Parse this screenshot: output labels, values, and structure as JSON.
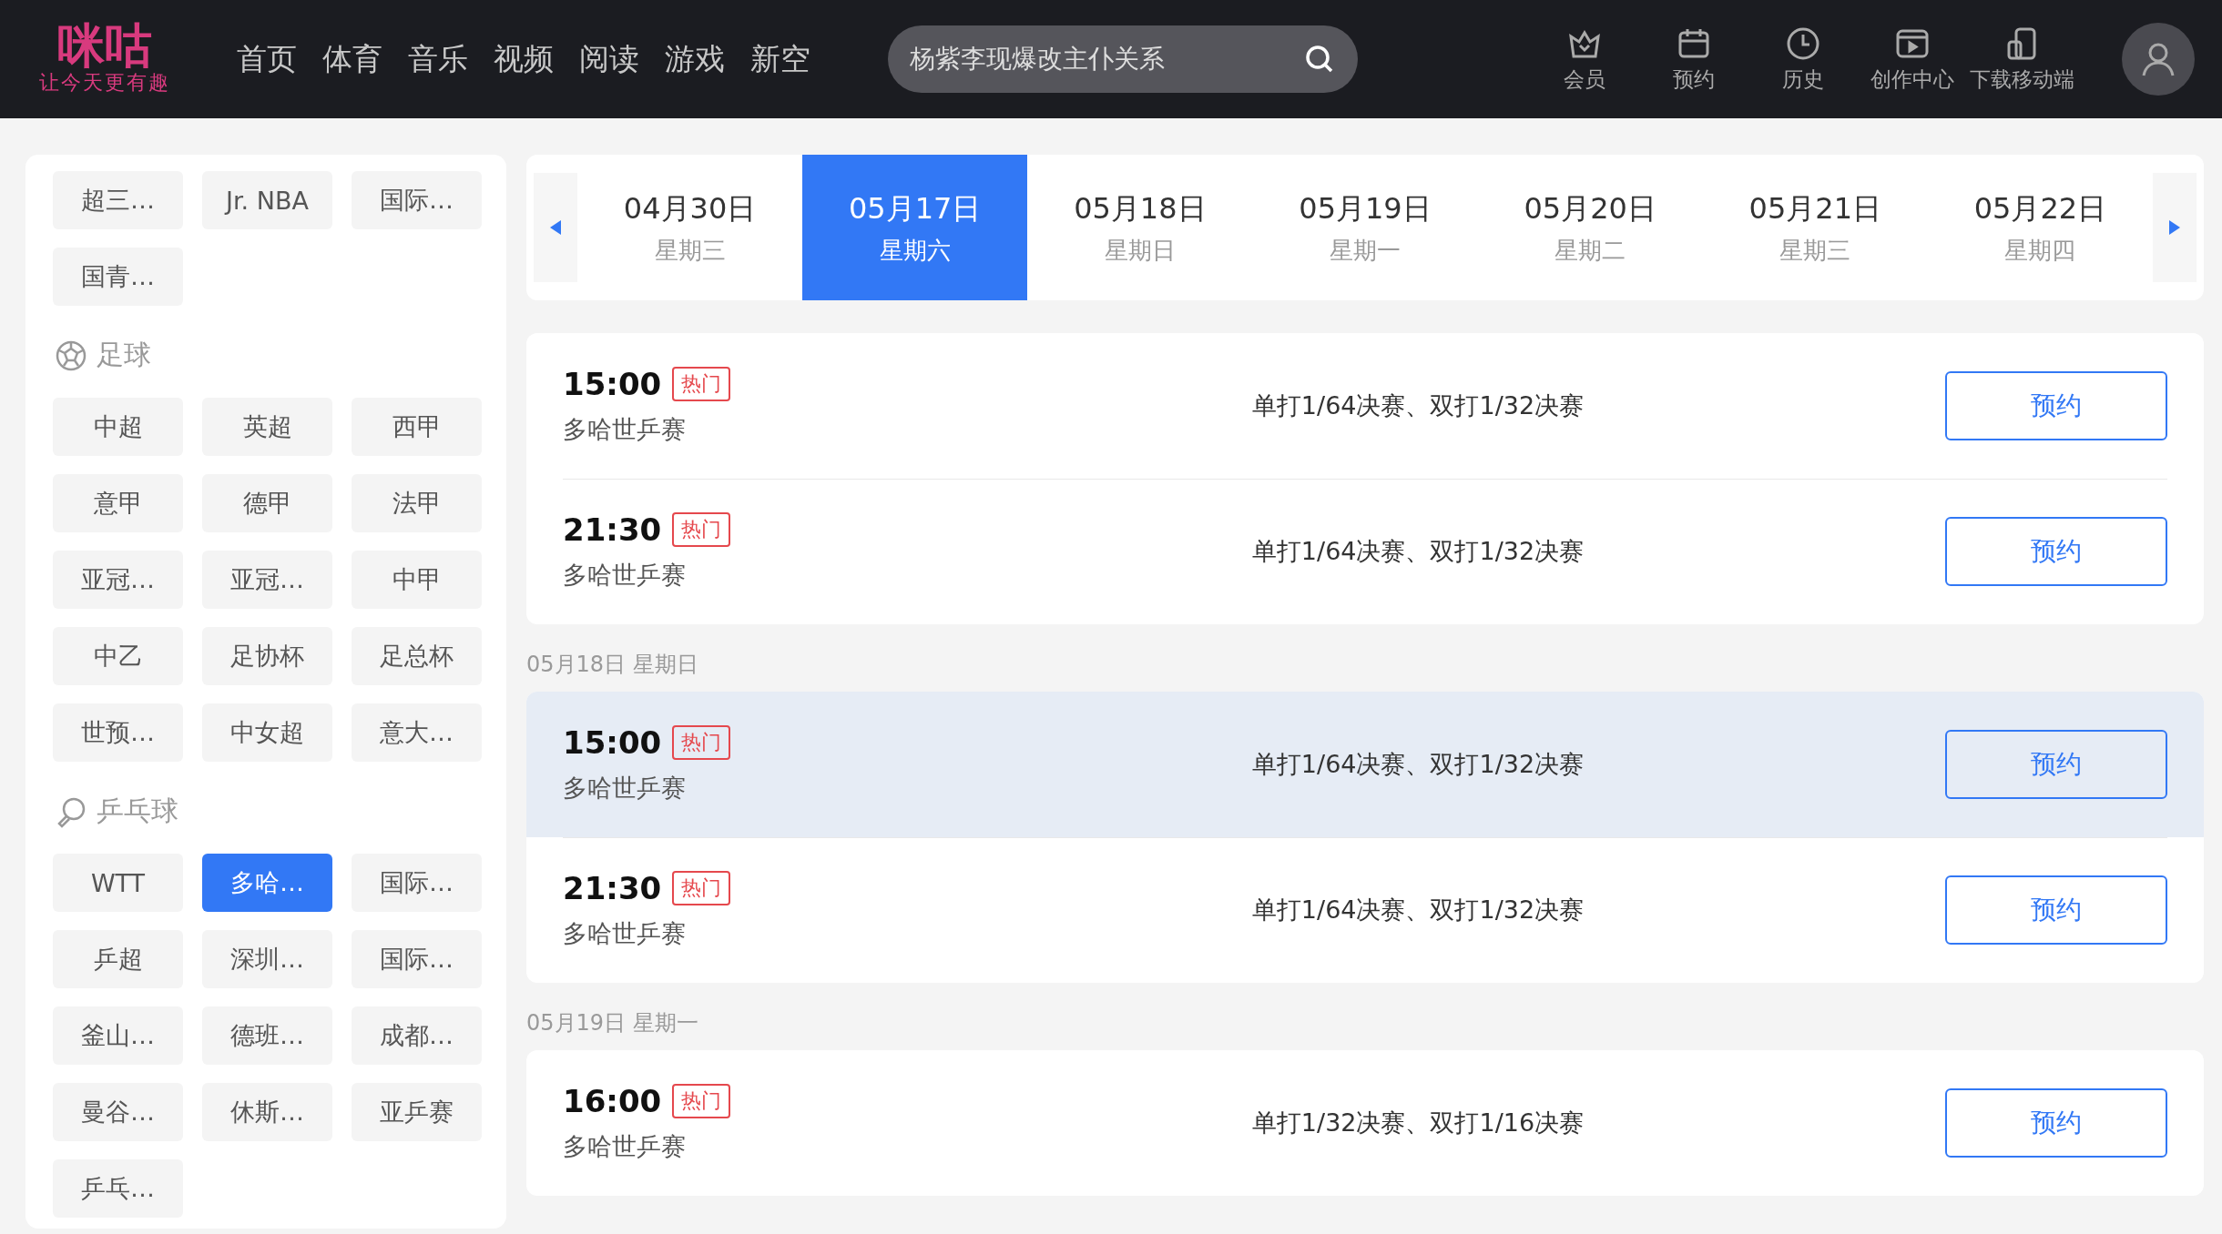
{
  "header": {
    "logo": {
      "name": "咪咕",
      "slogan": "让今天更有趣"
    },
    "nav": [
      {
        "label": "首页"
      },
      {
        "label": "体育"
      },
      {
        "label": "音乐"
      },
      {
        "label": "视频"
      },
      {
        "label": "阅读"
      },
      {
        "label": "游戏"
      },
      {
        "label": "新空"
      }
    ],
    "search": {
      "value": "杨紫李现爆改主仆关系"
    },
    "actions": [
      {
        "kind": "crown",
        "label": "会员"
      },
      {
        "kind": "calendar",
        "label": "预约"
      },
      {
        "kind": "clock",
        "label": "历史"
      },
      {
        "kind": "video",
        "label": "创作中心"
      },
      {
        "kind": "phone",
        "label": "下载移动端"
      }
    ]
  },
  "sidebar": {
    "sections": [
      {
        "items": [
          {
            "label": "超三…",
            "selected": false
          },
          {
            "label": "Jr. NBA",
            "selected": false
          },
          {
            "label": "国际…",
            "selected": false
          },
          {
            "label": "国青…",
            "selected": false
          }
        ]
      },
      {
        "title": "足球",
        "kind": "football",
        "items": [
          {
            "label": "中超",
            "selected": false
          },
          {
            "label": "英超",
            "selected": false
          },
          {
            "label": "西甲",
            "selected": false
          },
          {
            "label": "意甲",
            "selected": false
          },
          {
            "label": "德甲",
            "selected": false
          },
          {
            "label": "法甲",
            "selected": false
          },
          {
            "label": "亚冠…",
            "selected": false
          },
          {
            "label": "亚冠…",
            "selected": false
          },
          {
            "label": "中甲",
            "selected": false
          },
          {
            "label": "中乙",
            "selected": false
          },
          {
            "label": "足协杯",
            "selected": false
          },
          {
            "label": "足总杯",
            "selected": false
          },
          {
            "label": "世预…",
            "selected": false
          },
          {
            "label": "中女超",
            "selected": false
          },
          {
            "label": "意大…",
            "selected": false
          }
        ]
      },
      {
        "title": "乒乓球",
        "kind": "pingpong",
        "items": [
          {
            "label": "WTT",
            "selected": false
          },
          {
            "label": "多哈…",
            "selected": true
          },
          {
            "label": "国际…",
            "selected": false
          },
          {
            "label": "乒超",
            "selected": false
          },
          {
            "label": "深圳…",
            "selected": false
          },
          {
            "label": "国际…",
            "selected": false
          },
          {
            "label": "釜山…",
            "selected": false
          },
          {
            "label": "德班…",
            "selected": false
          },
          {
            "label": "成都…",
            "selected": false
          },
          {
            "label": "曼谷…",
            "selected": false
          },
          {
            "label": "休斯…",
            "selected": false
          },
          {
            "label": "亚乒赛",
            "selected": false
          },
          {
            "label": "乒乓…",
            "selected": false
          }
        ]
      }
    ]
  },
  "dates": [
    {
      "date": "04月30日",
      "weekday": "星期三",
      "selected": false
    },
    {
      "date": "05月17日",
      "weekday": "星期六",
      "selected": true
    },
    {
      "date": "05月18日",
      "weekday": "星期日",
      "selected": false
    },
    {
      "date": "05月19日",
      "weekday": "星期一",
      "selected": false
    },
    {
      "date": "05月20日",
      "weekday": "星期二",
      "selected": false
    },
    {
      "date": "05月21日",
      "weekday": "星期三",
      "selected": false
    },
    {
      "date": "05月22日",
      "weekday": "星期四",
      "selected": false
    }
  ],
  "schedule": [
    {
      "matches": [
        {
          "time": "15:00",
          "tag": "热门",
          "event": "多哈世乒赛",
          "round": "单打1/64决赛、双打1/32决赛",
          "button": "预约",
          "highlighted": false
        },
        {
          "time": "21:30",
          "tag": "热门",
          "event": "多哈世乒赛",
          "round": "单打1/64决赛、双打1/32决赛",
          "button": "预约",
          "highlighted": false
        }
      ]
    },
    {
      "date": "05月18日",
      "weekday": "星期日",
      "matches": [
        {
          "time": "15:00",
          "tag": "热门",
          "event": "多哈世乒赛",
          "round": "单打1/64决赛、双打1/32决赛",
          "button": "预约",
          "highlighted": true
        },
        {
          "time": "21:30",
          "tag": "热门",
          "event": "多哈世乒赛",
          "round": "单打1/64决赛、双打1/32决赛",
          "button": "预约",
          "highlighted": false
        }
      ]
    },
    {
      "date": "05月19日",
      "weekday": "星期一",
      "matches": [
        {
          "time": "16:00",
          "tag": "热门",
          "event": "多哈世乒赛",
          "round": "单打1/32决赛、双打1/16决赛",
          "button": "预约",
          "highlighted": false
        }
      ]
    }
  ]
}
